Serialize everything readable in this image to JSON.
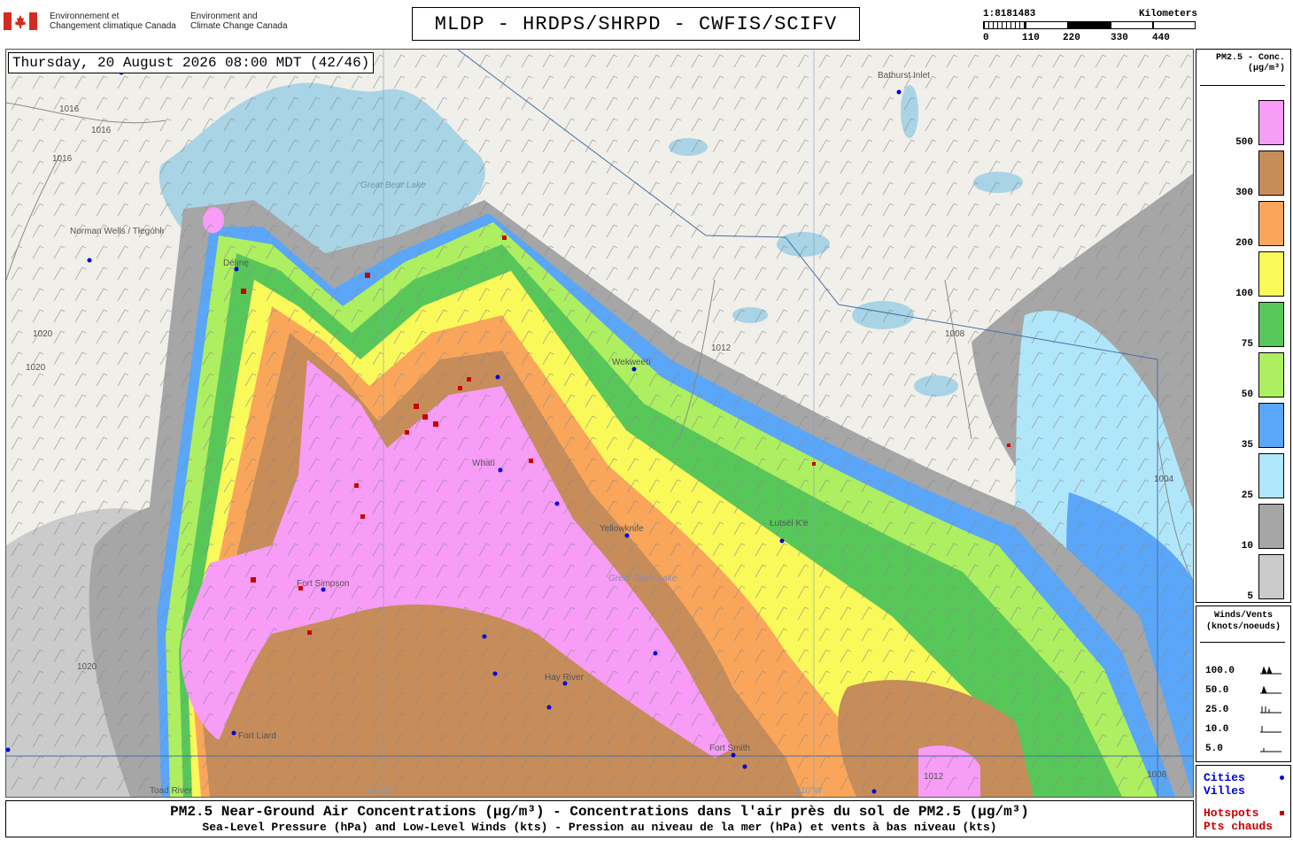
{
  "header": {
    "org_fr": [
      "Environnement et",
      "Changement climatique Canada"
    ],
    "org_en": [
      "Environment and",
      "Climate Change Canada"
    ],
    "title": "MLDP - HRDPS/SHRPD - CWFIS/SCIFV"
  },
  "scale": {
    "ratio": "1:8181483",
    "unit": "Kilometers",
    "ticks": [
      "0",
      "110",
      "220",
      "330",
      "440"
    ]
  },
  "map": {
    "datetime": "Thursday, 20 August 2026 08:00 MDT (42/46)",
    "cities": [
      "Norman Wells / Tłegóhłı",
      "Délı̨nę",
      "Bathurst Inlet",
      "Wekweètì",
      "Whatì",
      "Yellowknife",
      "Łutsël K'é",
      "Fort Simpson",
      "Hay River",
      "Fort Smith",
      "Fort Liard",
      "Toad River"
    ],
    "lakes": [
      "Great Bear Lake",
      "Great Slave Lake"
    ],
    "isobars": [
      "1016",
      "1016",
      "1016",
      "1020",
      "1020",
      "1020",
      "1012",
      "1008",
      "1004",
      "1008",
      "1012"
    ],
    "meridians": [
      "120°W",
      "110°W"
    ]
  },
  "pm_legend": {
    "title": [
      "PM2.5 - Conc.",
      "(µg/m³)"
    ],
    "classes": [
      {
        "label": "500",
        "color": "#f79cf7"
      },
      {
        "label": "300",
        "color": "#c68c5a"
      },
      {
        "label": "200",
        "color": "#f9a65a"
      },
      {
        "label": "100",
        "color": "#f9f95a"
      },
      {
        "label": "75",
        "color": "#58c75a"
      },
      {
        "label": "50",
        "color": "#adef60"
      },
      {
        "label": "35",
        "color": "#5aa6f9"
      },
      {
        "label": "25",
        "color": "#b0e6f9"
      },
      {
        "label": "10",
        "color": "#a6a6a6"
      },
      {
        "label": "5",
        "color": "#cbcbcb"
      }
    ]
  },
  "wind_legend": {
    "title": [
      "Winds/Vents",
      "(knots/noeuds)"
    ],
    "speeds": [
      "100.0",
      "50.0",
      "25.0",
      "10.0",
      "5.0"
    ]
  },
  "cities_legend": {
    "cities": [
      "Cities",
      "Villes"
    ],
    "hotspots": [
      "Hotspots",
      "Pts chauds"
    ],
    "city_color": "#0000dd",
    "hotspot_color": "#cc0000"
  },
  "footer": {
    "line1": "PM2.5 Near-Ground Air Concentrations (µg/m³) - Concentrations dans l'air près du sol de PM2.5 (µg/m³)",
    "line2": "Sea-Level Pressure (hPa) and Low-Level Winds (kts) - Pression au niveau de la mer (hPa) et vents à bas niveau (kts)"
  }
}
